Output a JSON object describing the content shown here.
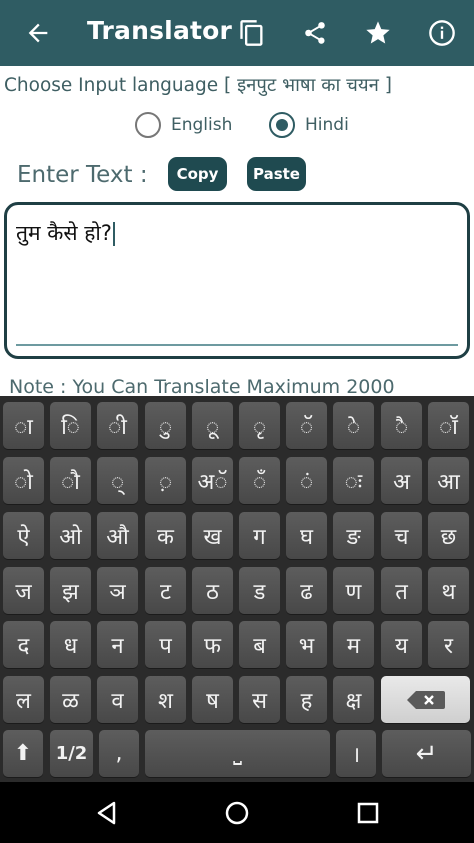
{
  "appbar": {
    "title": "Translator",
    "back_icon": "arrow-back-icon",
    "actions": [
      "copy-icon",
      "share-icon",
      "star-icon",
      "info-icon"
    ]
  },
  "input_language": {
    "label": "Choose Input language [ इनपुट भाषा का चयन  ]",
    "options": [
      {
        "label": "English",
        "selected": false
      },
      {
        "label": "Hindi",
        "selected": true
      }
    ]
  },
  "enter_text": {
    "label": "Enter Text :",
    "copy_label": "Copy",
    "paste_label": "Paste"
  },
  "textbox": {
    "value": "तुम कैसे हो?"
  },
  "note": "Note  :  You Can Translate Maximum 2000",
  "keyboard": {
    "rows": [
      [
        "◌ा",
        "◌ि",
        "◌ी",
        "◌ु",
        "◌ू",
        "◌ृ",
        "◌ॅ",
        "◌े",
        "◌ै",
        "◌ॉ"
      ],
      [
        "◌ो",
        "◌ौ",
        "◌्",
        "◌़",
        "अॅ",
        "◌ँ",
        "◌ं",
        "◌ः",
        "अ",
        "आ"
      ],
      [
        "ऐ",
        "ओ",
        "औ",
        "क",
        "ख",
        "ग",
        "घ",
        "ङ",
        "च",
        "छ"
      ],
      [
        "ज",
        "झ",
        "ञ",
        "ट",
        "ठ",
        "ड",
        "ढ",
        "ण",
        "त",
        "थ"
      ],
      [
        "द",
        "ध",
        "न",
        "प",
        "फ",
        "ब",
        "भ",
        "म",
        "य",
        "र"
      ],
      [
        "ल",
        "ळ",
        "व",
        "श",
        "ष",
        "स",
        "ह",
        "क्ष",
        "backspace"
      ]
    ],
    "bottom": {
      "shift": "⬆",
      "page": "1/2",
      "comma": ",",
      "space": "⎵",
      "danda": "।",
      "enter": "↵"
    }
  },
  "colors": {
    "primary": "#2f5c63",
    "button_dark": "#1f4a50",
    "keyboard_bg": "#2b2b2b",
    "key": "#525252",
    "key_light": "#dcdcdc"
  }
}
